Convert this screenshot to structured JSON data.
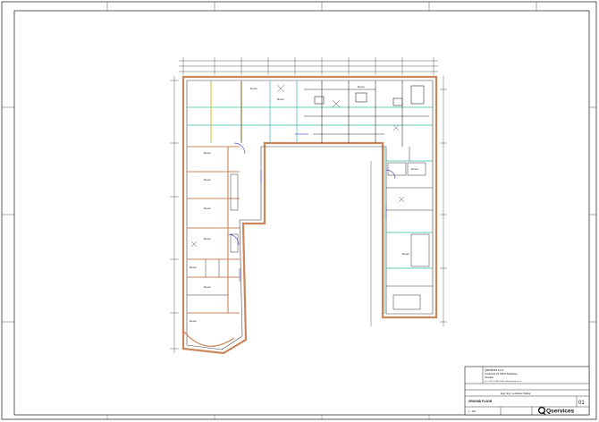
{
  "title_block": {
    "company_name": "Qservices s.r.o.",
    "address_line1": "Ursulínska 25, 81101 Bratislava",
    "address_line2": "Slovakia",
    "contact": "tel.: +421 2 5443 0000, info@qservices.sk",
    "project": "Egii ring. Leistikov Palbaj",
    "drawing_title": "GROUND FLOOR",
    "sheet_number": "01",
    "scale_label": "1 : 100",
    "logo_text": "Qservices"
  },
  "plan": {
    "room_labels": [
      "Room",
      "Room",
      "Room",
      "Room",
      "Room",
      "Room",
      "Room",
      "Room",
      "Room",
      "Room",
      "Room",
      "Room"
    ]
  },
  "colors": {
    "wall": "#c8865a",
    "grid": "#39b6a8",
    "door": "#5a4fd0",
    "line": "#222222",
    "accent_yellow": "#d6c84a"
  }
}
